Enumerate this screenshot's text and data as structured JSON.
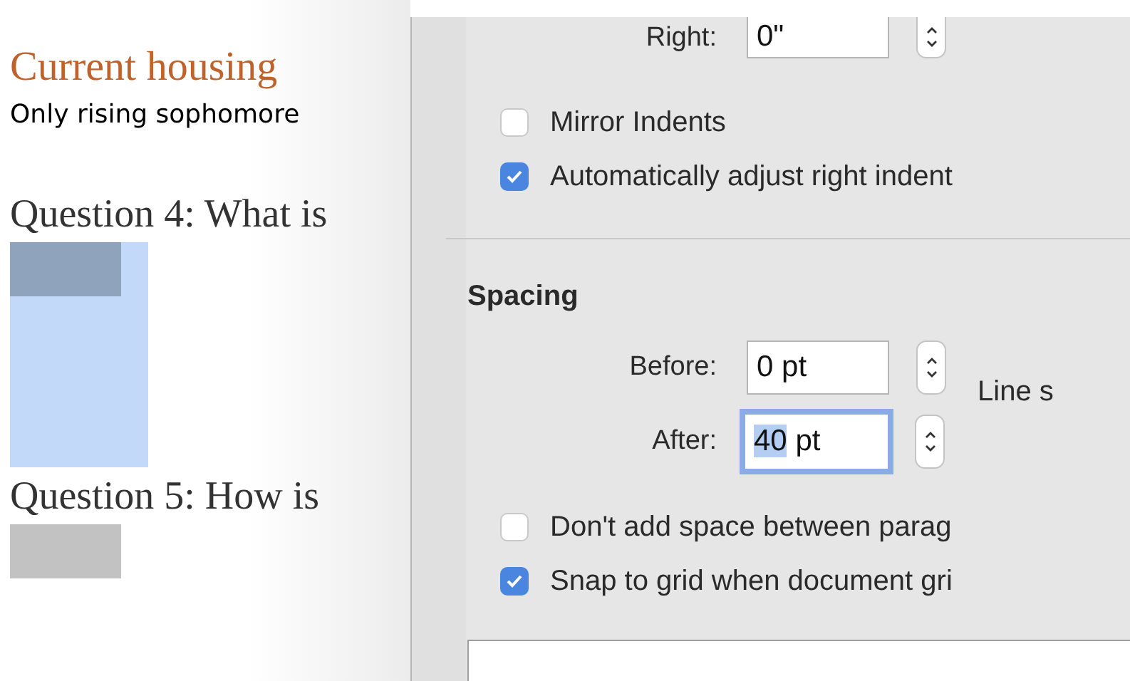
{
  "document": {
    "heading": "Current housing",
    "body": "Only rising sophomore",
    "questions": [
      {
        "text": "Question 4: What is",
        "answer_selected": true
      },
      {
        "text": "Question 5: How is",
        "answer_selected": false
      }
    ]
  },
  "indents": {
    "right": {
      "label": "Right:",
      "value": "0\""
    },
    "options": [
      {
        "label": "Mirror Indents",
        "checked": false
      },
      {
        "label": "Automatically adjust right indent",
        "checked": true
      }
    ]
  },
  "spacing": {
    "title": "Spacing",
    "line_spacing_label": "Line s",
    "fields": [
      {
        "label": "Before:",
        "focused": false,
        "value_parts": [
          {
            "text": "0 pt",
            "selected": false
          }
        ]
      },
      {
        "label": "After:",
        "focused": true,
        "value_parts": [
          {
            "text": "40",
            "selected": true
          },
          {
            "text": " pt",
            "selected": false
          }
        ]
      }
    ],
    "options": [
      {
        "label": "Don't add space between parag",
        "checked": false
      },
      {
        "label": "Snap to grid when document gri",
        "checked": true
      }
    ]
  }
}
